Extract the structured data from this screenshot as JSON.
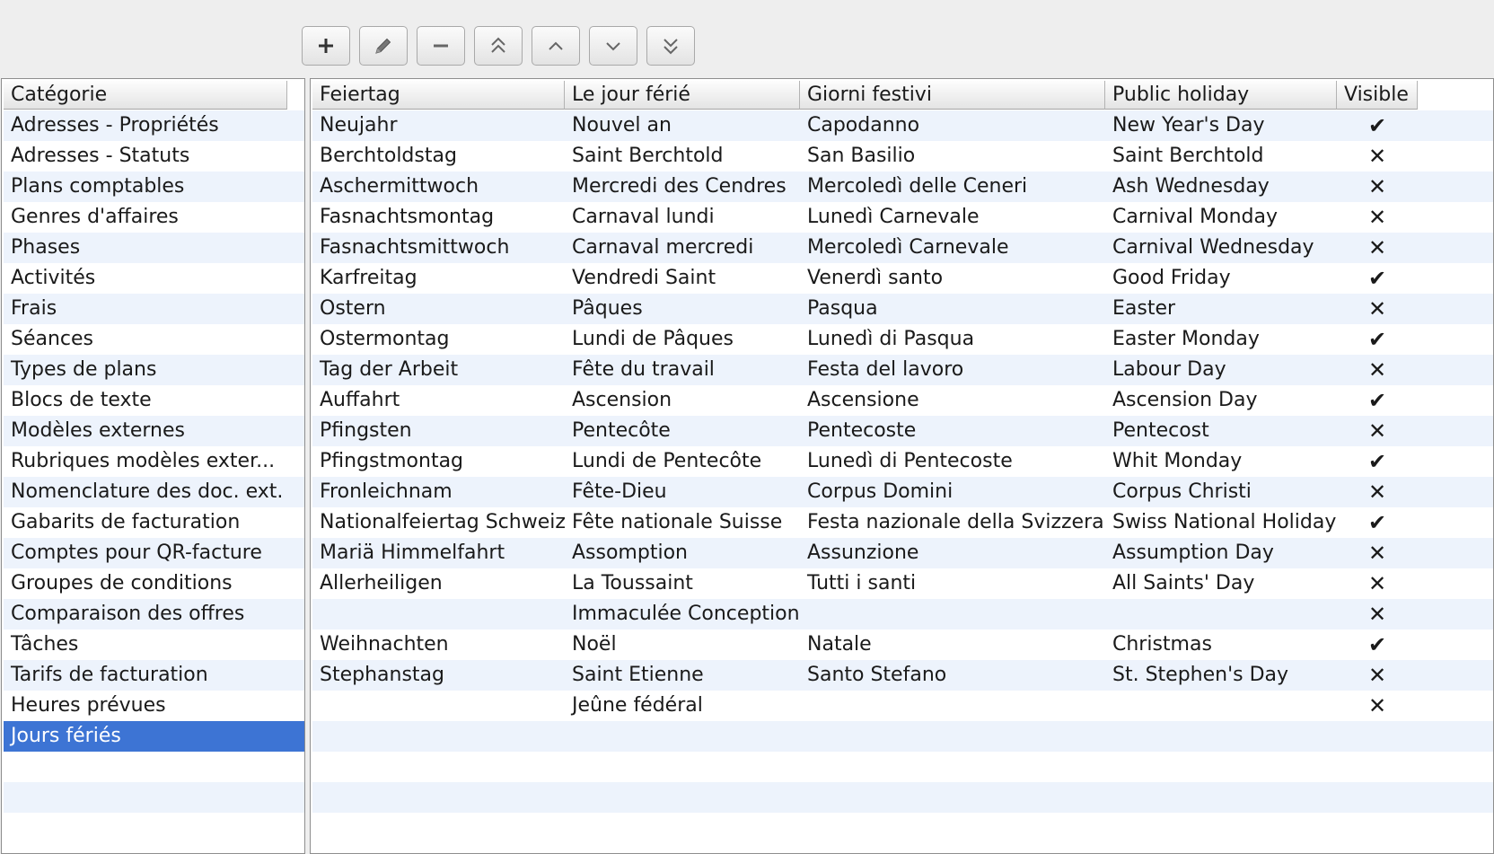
{
  "toolbar": {
    "buttons": [
      {
        "icon": "plus-icon"
      },
      {
        "icon": "pencil-icon"
      },
      {
        "icon": "minus-icon"
      },
      {
        "icon": "double-chevron-up-icon"
      },
      {
        "icon": "chevron-up-icon"
      },
      {
        "icon": "chevron-down-icon"
      },
      {
        "icon": "double-chevron-down-icon"
      }
    ]
  },
  "categories": {
    "header": "Catégorie",
    "selected": "Jours fériés",
    "items": [
      "Adresses - Propriétés",
      "Adresses - Statuts",
      "Plans comptables",
      "Genres d'affaires",
      "Phases",
      "Activités",
      "Frais",
      "Séances",
      "Types de plans",
      "Blocs de texte",
      "Modèles externes",
      "Rubriques modèles exter...",
      "Nomenclature des doc. ext.",
      "Gabarits de facturation",
      "Comptes pour QR-facture",
      "Groupes de conditions",
      "Comparaison des offres",
      "Tâches",
      "Tarifs de facturation",
      "Heures prévues",
      "Jours fériés"
    ]
  },
  "holidays": {
    "columns": [
      "Feiertag",
      "Le jour férié",
      "Giorni festivi",
      "Public holiday",
      "Visible"
    ],
    "visible_symbols": {
      "yes": "✔",
      "no": "✕"
    },
    "rows": [
      {
        "de": "Neujahr",
        "fr": "Nouvel an",
        "it": "Capodanno",
        "en": "New Year's Day",
        "visible": true
      },
      {
        "de": "Berchtoldstag",
        "fr": "Saint Berchtold",
        "it": "San Basilio",
        "en": "Saint Berchtold",
        "visible": false
      },
      {
        "de": "Aschermittwoch",
        "fr": "Mercredi des Cendres",
        "it": "Mercoledì delle Ceneri",
        "en": "Ash Wednesday",
        "visible": false
      },
      {
        "de": "Fasnachtsmontag",
        "fr": "Carnaval lundi",
        "it": "Lunedì Carnevale",
        "en": "Carnival Monday",
        "visible": false
      },
      {
        "de": "Fasnachtsmittwoch",
        "fr": "Carnaval mercredi",
        "it": "Mercoledì Carnevale",
        "en": "Carnival Wednesday",
        "visible": false
      },
      {
        "de": "Karfreitag",
        "fr": "Vendredi Saint",
        "it": "Venerdì santo",
        "en": "Good Friday",
        "visible": true
      },
      {
        "de": "Ostern",
        "fr": "Pâques",
        "it": "Pasqua",
        "en": "Easter",
        "visible": false
      },
      {
        "de": "Ostermontag",
        "fr": "Lundi de Pâques",
        "it": "Lunedì di Pasqua",
        "en": "Easter Monday",
        "visible": true
      },
      {
        "de": "Tag der Arbeit",
        "fr": "Fête du travail",
        "it": "Festa del lavoro",
        "en": "Labour Day",
        "visible": false
      },
      {
        "de": "Auffahrt",
        "fr": "Ascension",
        "it": "Ascensione",
        "en": "Ascension Day",
        "visible": true
      },
      {
        "de": "Pfingsten",
        "fr": "Pentecôte",
        "it": "Pentecoste",
        "en": "Pentecost",
        "visible": false
      },
      {
        "de": "Pfingstmontag",
        "fr": "Lundi de Pentecôte",
        "it": "Lunedì di Pentecoste",
        "en": "Whit Monday",
        "visible": true
      },
      {
        "de": "Fronleichnam",
        "fr": "Fête-Dieu",
        "it": "Corpus Domini",
        "en": "Corpus Christi",
        "visible": false
      },
      {
        "de": "Nationalfeiertag Schweiz",
        "fr": "Fête nationale Suisse",
        "it": "Festa nazionale della Svizzera",
        "en": "Swiss National Holiday",
        "visible": true
      },
      {
        "de": "Mariä Himmelfahrt",
        "fr": "Assomption",
        "it": "Assunzione",
        "en": "Assumption Day",
        "visible": false
      },
      {
        "de": "Allerheiligen",
        "fr": "La Toussaint",
        "it": "Tutti i santi",
        "en": "All Saints' Day",
        "visible": false
      },
      {
        "de": "",
        "fr": "Immaculée Conception",
        "it": "",
        "en": "",
        "visible": false
      },
      {
        "de": "Weihnachten",
        "fr": "Noël",
        "it": "Natale",
        "en": "Christmas",
        "visible": true
      },
      {
        "de": "Stephanstag",
        "fr": "Saint Etienne",
        "it": "Santo Stefano",
        "en": "St. Stephen's Day",
        "visible": false
      },
      {
        "de": "",
        "fr": "Jeûne fédéral",
        "it": "",
        "en": "",
        "visible": false
      }
    ]
  },
  "colors": {
    "selection": "#3d74d4",
    "stripe": "#edf3fc",
    "window": "#eeeeee"
  }
}
